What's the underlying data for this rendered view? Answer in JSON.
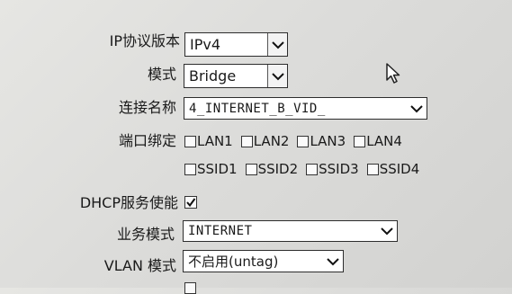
{
  "form": {
    "ip_version": {
      "label": "IP协议版本",
      "value": "IPv4"
    },
    "mode": {
      "label": "模式",
      "value": "Bridge"
    },
    "connection_name": {
      "label": "连接名称",
      "value": "4_INTERNET_B_VID_"
    },
    "port_binding": {
      "label": "端口绑定",
      "lan": [
        "LAN1",
        "LAN2",
        "LAN3",
        "LAN4"
      ],
      "ssid": [
        "SSID1",
        "SSID2",
        "SSID3",
        "SSID4"
      ]
    },
    "dhcp": {
      "label": "DHCP服务使能",
      "checked": true
    },
    "service_mode": {
      "label": "业务模式",
      "value": "INTERNET"
    },
    "vlan_mode": {
      "label": "VLAN 模式",
      "value": "不启用(untag)"
    }
  },
  "icons": {
    "dropdown": "chevron-down-icon",
    "check": "checkmark-icon",
    "pointer": "mouse-cursor-icon"
  }
}
